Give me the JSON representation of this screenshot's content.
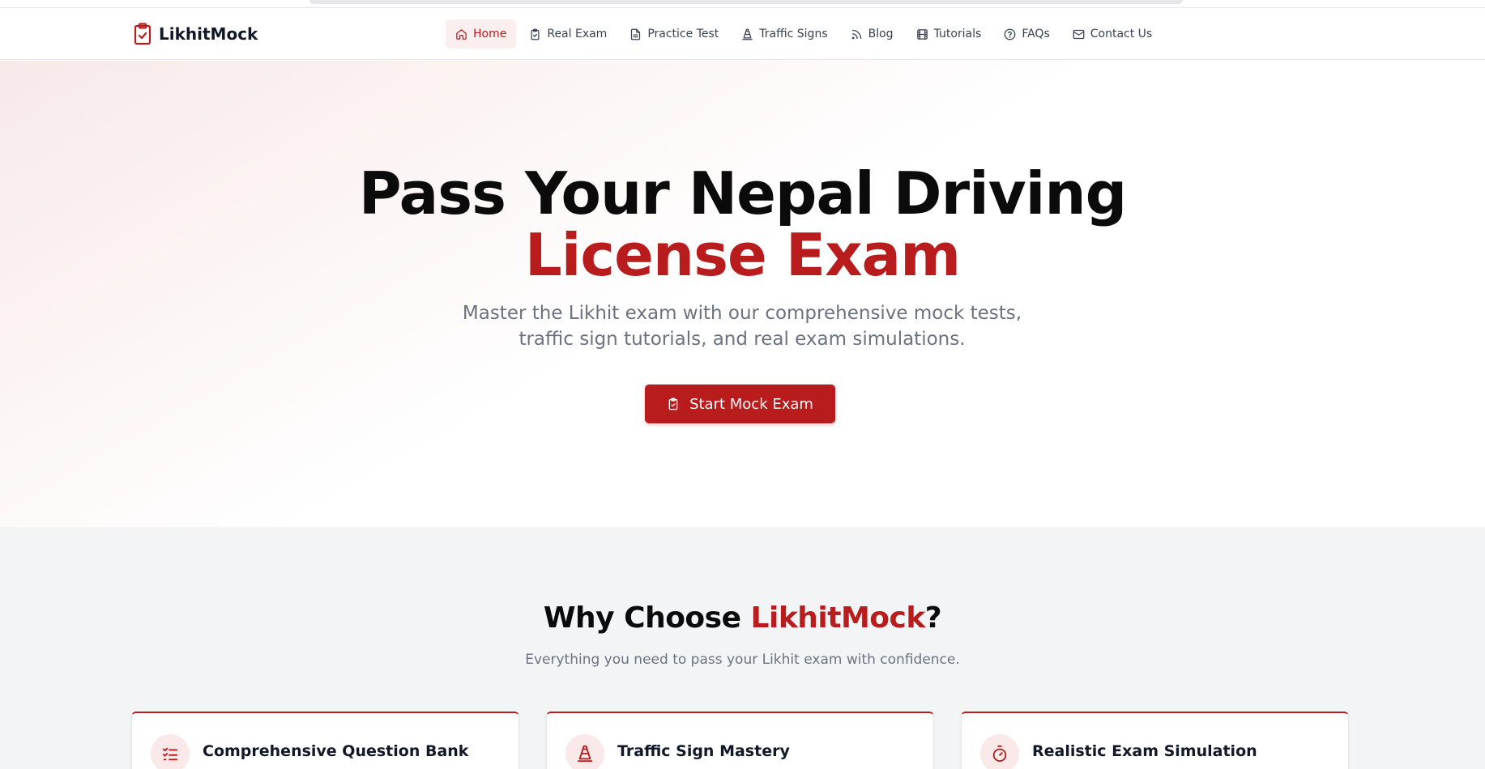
{
  "brand": {
    "name": "LikhitMock",
    "icon": "clipboard-check-icon"
  },
  "nav": {
    "items": [
      {
        "label": "Home",
        "icon": "home-icon",
        "active": true
      },
      {
        "label": "Real Exam",
        "icon": "clipboard-icon"
      },
      {
        "label": "Practice Test",
        "icon": "file-text-icon"
      },
      {
        "label": "Traffic Signs",
        "icon": "traffic-cone-icon"
      },
      {
        "label": "Blog",
        "icon": "rss-icon"
      },
      {
        "label": "Tutorials",
        "icon": "film-icon"
      },
      {
        "label": "FAQs",
        "icon": "help-circle-icon"
      },
      {
        "label": "Contact Us",
        "icon": "mail-icon"
      }
    ]
  },
  "hero": {
    "title_line1": "Pass Your Nepal Driving",
    "title_line2": "License Exam",
    "subtitle": "Master the Likhit exam with our comprehensive mock tests, traffic sign tutorials, and real exam simulations.",
    "cta_label": "Start Mock Exam",
    "cta_icon": "clipboard-icon"
  },
  "features": {
    "title_prefix": "Why Choose ",
    "title_brand": "LikhitMock",
    "title_suffix": "?",
    "subtitle": "Everything you need to pass your Likhit exam with confidence.",
    "cards": [
      {
        "title": "Comprehensive Question Bank",
        "icon": "list-checks-icon"
      },
      {
        "title": "Traffic Sign Mastery",
        "icon": "traffic-cone-icon"
      },
      {
        "title": "Realistic Exam Simulation",
        "icon": "timer-icon"
      }
    ]
  },
  "colors": {
    "accent": "#b91c1c",
    "accent_soft": "#fbeeee",
    "text": "#111827",
    "muted": "#6b7280",
    "section_bg": "#f3f4f6"
  }
}
